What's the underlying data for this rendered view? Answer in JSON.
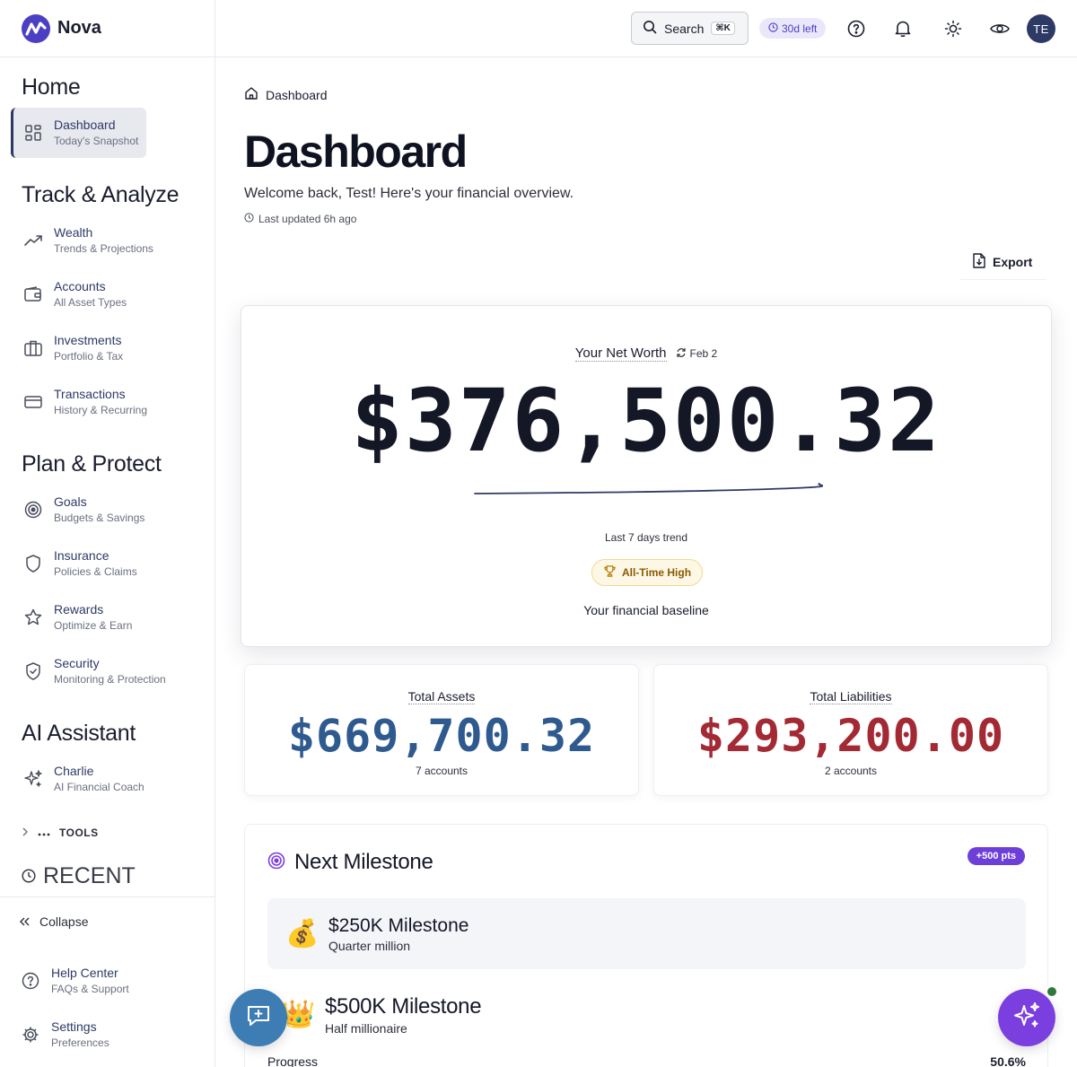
{
  "app": {
    "name": "Nova"
  },
  "sidebar": {
    "sections": {
      "home": "Home",
      "track": "Track & Analyze",
      "plan": "Plan & Protect",
      "ai": "AI Assistant"
    },
    "items": {
      "dashboard": {
        "label": "Dashboard",
        "sub": "Today's Snapshot"
      },
      "wealth": {
        "label": "Wealth",
        "sub": "Trends & Projections"
      },
      "accounts": {
        "label": "Accounts",
        "sub": "All Asset Types"
      },
      "investments": {
        "label": "Investments",
        "sub": "Portfolio & Tax"
      },
      "transactions": {
        "label": "Transactions",
        "sub": "History & Recurring"
      },
      "goals": {
        "label": "Goals",
        "sub": "Budgets & Savings"
      },
      "insurance": {
        "label": "Insurance",
        "sub": "Policies & Claims"
      },
      "rewards": {
        "label": "Rewards",
        "sub": "Optimize & Earn"
      },
      "security": {
        "label": "Security",
        "sub": "Monitoring & Protection"
      },
      "charlie": {
        "label": "Charlie",
        "sub": "AI Financial Coach"
      },
      "help": {
        "label": "Help Center",
        "sub": "FAQs & Support"
      },
      "settings": {
        "label": "Settings",
        "sub": "Preferences"
      }
    },
    "tools_label": "TOOLS",
    "recent_label": "RECENT",
    "collapse_label": "Collapse"
  },
  "header": {
    "search_label": "Search",
    "search_shortcut": "⌘K",
    "trial_label": "30d left",
    "avatar_initials": "TE"
  },
  "main": {
    "breadcrumb": "Dashboard",
    "title": "Dashboard",
    "welcome": "Welcome back, Test! Here's your financial overview.",
    "last_updated": "Last updated 6h ago",
    "export_label": "Export",
    "net_worth": {
      "label": "Your Net Worth",
      "date": "Feb 2",
      "value": "$376,500.32",
      "trend_label": "Last 7 days trend",
      "badge": "All-Time High",
      "caption": "Your financial baseline"
    },
    "assets": {
      "label": "Total Assets",
      "value": "$669,700.32",
      "sub": "7 accounts",
      "color": "#2f5a8f"
    },
    "liabilities": {
      "label": "Total Liabilities",
      "value": "$293,200.00",
      "sub": "2 accounts",
      "color": "#a32a34"
    },
    "milestone": {
      "title": "Next Milestone",
      "points": "+500 pts",
      "current": {
        "icon": "money-bag",
        "name": "$250K Milestone",
        "desc": "Quarter million"
      },
      "next": {
        "icon": "crown",
        "name": "$500K Milestone",
        "desc": "Half millionaire"
      },
      "progress_label": "Progress",
      "progress_value": "50.6%"
    }
  },
  "colors": {
    "accent": "#4b3fc4",
    "sidebar_active": "#2e3a66",
    "ai_fab": "#7b3fe0",
    "feedback_fab": "#3e7db3"
  }
}
